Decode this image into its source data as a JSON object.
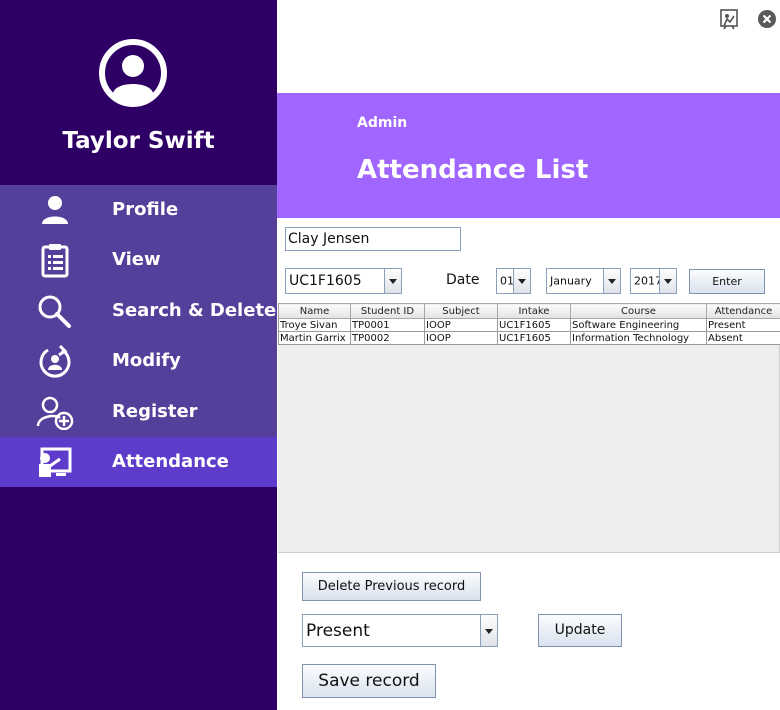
{
  "user": {
    "name": "Taylor Swift"
  },
  "sidebar": {
    "items": [
      {
        "label": "Profile",
        "icon": "person-icon"
      },
      {
        "label": "View",
        "icon": "clipboard-list-icon"
      },
      {
        "label": "Search & Delete",
        "icon": "search-icon"
      },
      {
        "label": "Modify",
        "icon": "refresh-person-icon"
      },
      {
        "label": "Register",
        "icon": "add-user-icon"
      },
      {
        "label": "Attendance",
        "icon": "teacher-board-icon",
        "active": true
      }
    ]
  },
  "header": {
    "role": "Admin",
    "title": "Attendance List"
  },
  "form": {
    "student_name": "Clay Jensen",
    "intake": "UC1F1605",
    "date_label": "Date",
    "day": "01",
    "month": "January",
    "year": "2017",
    "enter_label": "Enter"
  },
  "table": {
    "columns": [
      "Name",
      "Student ID",
      "Subject",
      "Intake",
      "Course",
      "Attendance"
    ],
    "rows": [
      [
        "Troye Sivan",
        "TP0001",
        "IOOP",
        "UC1F1605",
        "Software Engineering",
        "Present"
      ],
      [
        "Martin Garrix",
        "TP0002",
        "IOOP",
        "UC1F1605",
        "Information Technology",
        "Absent"
      ]
    ]
  },
  "actions": {
    "delete_label": "Delete Previous record",
    "status_value": "Present",
    "update_label": "Update",
    "save_label": "Save record"
  },
  "colors": {
    "sidebar_bg": "#2e0066",
    "menu_bg": "#54409a",
    "active_bg": "#5d3ccc",
    "banner_bg": "#a066ff"
  }
}
